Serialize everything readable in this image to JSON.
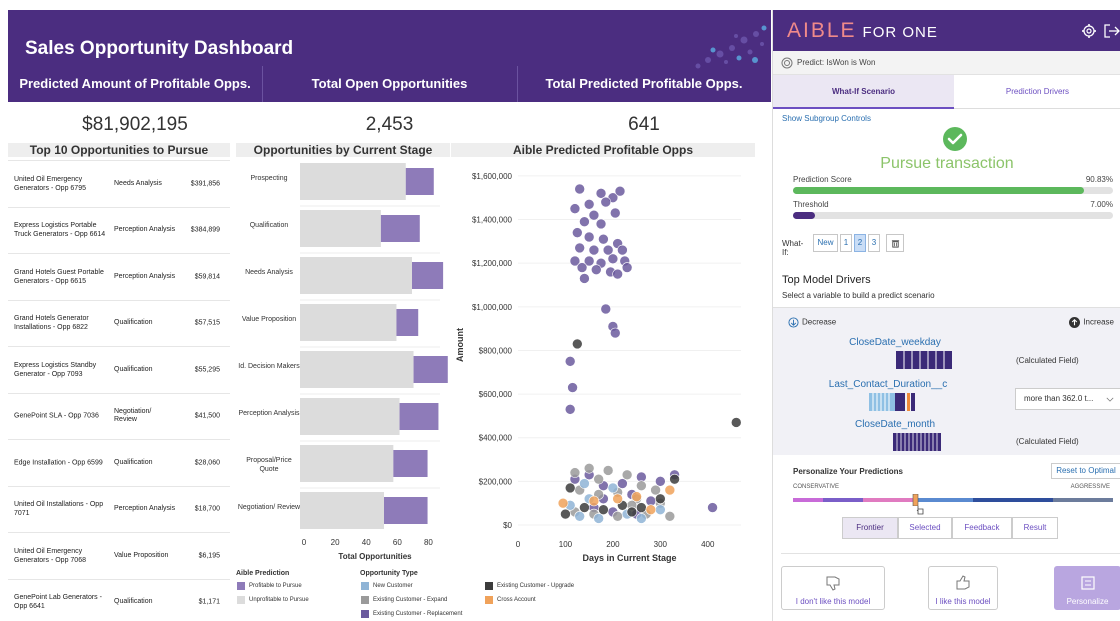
{
  "dashboard": {
    "title": "Sales Opportunity Dashboard",
    "kpis": [
      {
        "label": "Predicted Amount of Profitable Opps.",
        "value": "$81,902,195"
      },
      {
        "label": "Total Open Opportunities",
        "value": "2,453"
      },
      {
        "label": "Total Predicted Profitable Opps.",
        "value": "641"
      }
    ],
    "top10": {
      "title": "Top 10 Opportunities to Pursue",
      "rows": [
        {
          "name": "United Oil Emergency Generators - Opp 6795",
          "stage": "Needs Analysis",
          "amount": "$391,856"
        },
        {
          "name": "Express Logistics Portable Truck Generators - Opp 6614",
          "stage": "Perception Analysis",
          "amount": "$384,899"
        },
        {
          "name": "Grand Hotels Guest Portable Generators - Opp 6615",
          "stage": "Perception Analysis",
          "amount": "$59,814"
        },
        {
          "name": "Grand Hotels Generator Installations - Opp 6822",
          "stage": "Qualification",
          "amount": "$57,515"
        },
        {
          "name": "Express Logistics Standby Generator - Opp 7093",
          "stage": "Qualification",
          "amount": "$55,295"
        },
        {
          "name": "GenePoint SLA - Opp 7036",
          "stage": "Negotiation/ Review",
          "amount": "$41,500"
        },
        {
          "name": "Edge Installation - Opp 6599",
          "stage": "Qualification",
          "amount": "$28,060"
        },
        {
          "name": "United Oil Installations - Opp 7071",
          "stage": "Perception Analysis",
          "amount": "$18,700"
        },
        {
          "name": "United Oil Emergency Generators - Opp 7068",
          "stage": "Value Proposition",
          "amount": "$6,195"
        },
        {
          "name": "GenePoint Lab Generators - Opp 6641",
          "stage": "Qualification",
          "amount": "$1,171"
        }
      ]
    },
    "legend": {
      "prediction_title": "Aible Prediction",
      "prediction_items": [
        "Profitable to Pursue",
        "Unprofitable to Pursue"
      ],
      "type_title": "Opportunity Type",
      "type_items": [
        "New Customer",
        "Existing Customer - Expand",
        "Existing Customer - Replacement",
        "Existing Customer - Upgrade",
        "Cross Account"
      ]
    },
    "colors": {
      "header": "#4b2d80",
      "profitable": "#8e7bb9",
      "unprofitable": "#dcdcdc",
      "new_customer": "#8fb4d6",
      "expand": "#9a9a9a",
      "replacement": "#6b5a9e",
      "upgrade": "#3c3c3c",
      "cross_account": "#f0a25a"
    }
  },
  "chart_data": [
    {
      "type": "bar",
      "title": "Opportunities by Current Stage",
      "xlabel": "Total Opportunities",
      "ylabel": "",
      "xlim": [
        0,
        90
      ],
      "ticks": [
        "0",
        "20",
        "40",
        "60",
        "80"
      ],
      "categories": [
        "Prospecting",
        "Qualification",
        "Needs Analysis",
        "Value Proposition",
        "Id. Decision Makers",
        "Perception Analysis",
        "Proposal/Price Quote",
        "Negotiation/ Review"
      ],
      "series": [
        {
          "name": "Unprofitable to Pursue",
          "values": [
            68,
            52,
            72,
            62,
            73,
            64,
            60,
            54
          ]
        },
        {
          "name": "Profitable to Pursue",
          "values": [
            18,
            25,
            20,
            14,
            22,
            25,
            22,
            28
          ]
        }
      ]
    },
    {
      "type": "scatter",
      "title": "Aible Predicted Profitable Opps",
      "xlabel": "Days in Current Stage",
      "ylabel": "Amount",
      "xlim": [
        0,
        470
      ],
      "ylim": [
        0,
        1650000
      ],
      "xticks": [
        "0",
        "100",
        "200",
        "300",
        "400"
      ],
      "yticks": [
        "$0",
        "$200,000",
        "$400,000",
        "$600,000",
        "$800,000",
        "$1,000,000",
        "$1,200,000",
        "$1,400,000",
        "$1,600,000"
      ],
      "series": [
        {
          "name": "Existing Customer - Replacement",
          "points": [
            [
              130,
              1540000
            ],
            [
              150,
              1470000
            ],
            [
              175,
              1520000
            ],
            [
              200,
              1500000
            ],
            [
              215,
              1530000
            ],
            [
              120,
              1450000
            ],
            [
              160,
              1420000
            ],
            [
              185,
              1480000
            ],
            [
              140,
              1390000
            ],
            [
              175,
              1380000
            ],
            [
              205,
              1430000
            ],
            [
              125,
              1340000
            ],
            [
              150,
              1320000
            ],
            [
              180,
              1310000
            ],
            [
              210,
              1290000
            ],
            [
              130,
              1270000
            ],
            [
              160,
              1260000
            ],
            [
              190,
              1260000
            ],
            [
              220,
              1260000
            ],
            [
              120,
              1210000
            ],
            [
              150,
              1210000
            ],
            [
              175,
              1200000
            ],
            [
              200,
              1220000
            ],
            [
              225,
              1210000
            ],
            [
              135,
              1180000
            ],
            [
              165,
              1170000
            ],
            [
              195,
              1160000
            ],
            [
              230,
              1180000
            ],
            [
              140,
              1130000
            ],
            [
              210,
              1150000
            ],
            [
              185,
              990000
            ],
            [
              200,
              910000
            ],
            [
              205,
              880000
            ],
            [
              110,
              750000
            ],
            [
              115,
              630000
            ],
            [
              110,
              530000
            ],
            [
              120,
              210000
            ],
            [
              150,
              230000
            ],
            [
              180,
              180000
            ],
            [
              220,
              190000
            ],
            [
              260,
              220000
            ],
            [
              300,
              200000
            ],
            [
              330,
              230000
            ],
            [
              180,
              120000
            ],
            [
              240,
              140000
            ],
            [
              280,
              110000
            ],
            [
              200,
              60000
            ],
            [
              250,
              50000
            ],
            [
              410,
              80000
            ],
            [
              160,
              80000
            ]
          ]
        },
        {
          "name": "Existing Customer - Expand",
          "points": [
            [
              120,
              240000
            ],
            [
              150,
              260000
            ],
            [
              170,
              210000
            ],
            [
              190,
              250000
            ],
            [
              230,
              230000
            ],
            [
              260,
              180000
            ],
            [
              290,
              160000
            ],
            [
              130,
              160000
            ],
            [
              170,
              140000
            ],
            [
              210,
              150000
            ],
            [
              250,
              120000
            ],
            [
              300,
              100000
            ],
            [
              120,
              60000
            ],
            [
              160,
              50000
            ],
            [
              210,
              40000
            ],
            [
              270,
              50000
            ],
            [
              320,
              40000
            ],
            [
              240,
              90000
            ]
          ]
        },
        {
          "name": "New Customer",
          "points": [
            [
              140,
              190000
            ],
            [
              200,
              170000
            ],
            [
              110,
              90000
            ],
            [
              130,
              40000
            ],
            [
              170,
              30000
            ],
            [
              230,
              50000
            ],
            [
              260,
              30000
            ],
            [
              300,
              70000
            ],
            [
              150,
              120000
            ]
          ]
        },
        {
          "name": "Existing Customer - Upgrade",
          "points": [
            [
              125,
              830000
            ],
            [
              460,
              470000
            ],
            [
              100,
              50000
            ],
            [
              140,
              80000
            ],
            [
              180,
              70000
            ],
            [
              220,
              90000
            ],
            [
              260,
              80000
            ],
            [
              300,
              120000
            ],
            [
              330,
              210000
            ],
            [
              110,
              170000
            ],
            [
              240,
              60000
            ]
          ]
        },
        {
          "name": "Cross Account",
          "points": [
            [
              95,
              100000
            ],
            [
              160,
              110000
            ],
            [
              210,
              120000
            ],
            [
              250,
              130000
            ],
            [
              320,
              160000
            ],
            [
              280,
              70000
            ]
          ]
        }
      ]
    }
  ],
  "aible": {
    "logo": "AIBLE",
    "logo_suffix": "FOR ONE",
    "predict_label": "Predict: IsWon is Won",
    "tabs": [
      "What-If Scenario",
      "Prediction Drivers"
    ],
    "subgroup_link": "Show Subgroup Controls",
    "verdict": "Pursue transaction",
    "prediction_score_label": "Prediction Score",
    "prediction_score_value": "90.83%",
    "prediction_score": 0.9083,
    "threshold_label": "Threshold",
    "threshold_value": "7.00%",
    "threshold": 0.07,
    "whatif_label": "What-If:",
    "whatif_buttons": [
      "New",
      "1",
      "2",
      "3"
    ],
    "drivers_title": "Top Model Drivers",
    "drivers_sub": "Select a variable to build a predict scenario",
    "decrease": "Decrease",
    "increase": "Increase",
    "variables": [
      {
        "name": "CloseDate_weekday",
        "value": "(Calculated Field)"
      },
      {
        "name": "Last_Contact_Duration__c",
        "value": "more than 362.0 t..."
      },
      {
        "name": "CloseDate_month",
        "value": "(Calculated Field)"
      }
    ],
    "personalize_title": "Personalize Your Predictions",
    "reset_label": "Reset to Optimal",
    "conservative": "CONSERVATIVE",
    "aggressive": "AGGRESSIVE",
    "segments": [
      "Frontier",
      "Selected",
      "Feedback",
      "Result"
    ],
    "actions": [
      "I don't like this model",
      "I like this model",
      "Personalize"
    ]
  }
}
